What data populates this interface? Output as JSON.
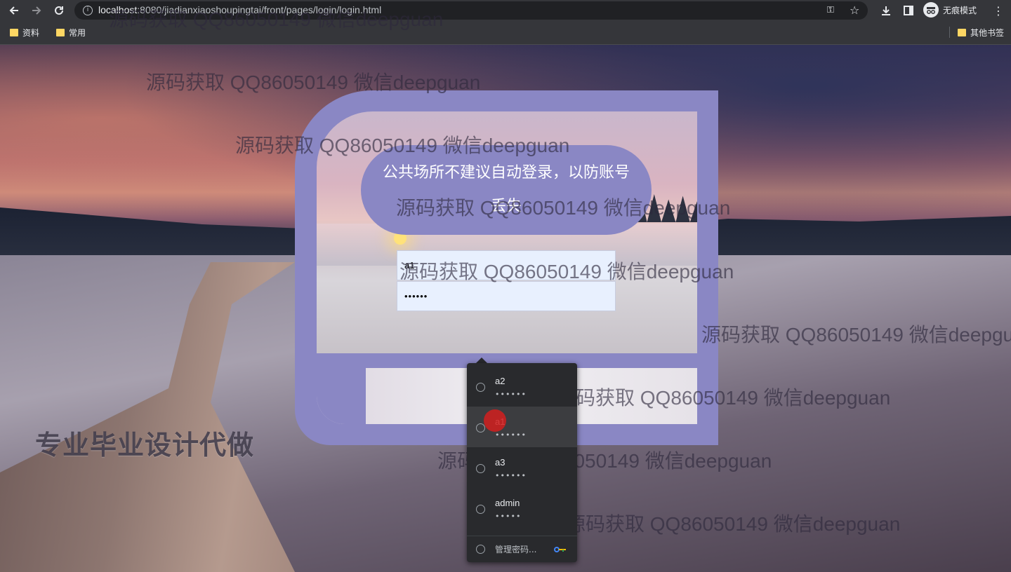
{
  "browser": {
    "url_host": "localhost",
    "url_rest": ":8080/jiadianxiaoshoupingtai/front/pages/login/login.html",
    "incognito_label": "无痕模式",
    "bookmarks": [
      "资料",
      "常用"
    ],
    "other_bookmarks": "其他书签"
  },
  "watermark": "源码获取 QQ86050149 微信deepguan",
  "ad_text": "专业毕业设计代做",
  "login": {
    "notice": "公共场所不建议自动登录，以防账号丢失",
    "username_value": "a1",
    "password_value": "••••••"
  },
  "autofill": {
    "items": [
      {
        "user": "a2",
        "pass": "••••••"
      },
      {
        "user": "a1",
        "pass": "••••••"
      },
      {
        "user": "a3",
        "pass": "••••••"
      },
      {
        "user": "admin",
        "pass": "•••••"
      }
    ],
    "manage_label": "管理密码..."
  }
}
